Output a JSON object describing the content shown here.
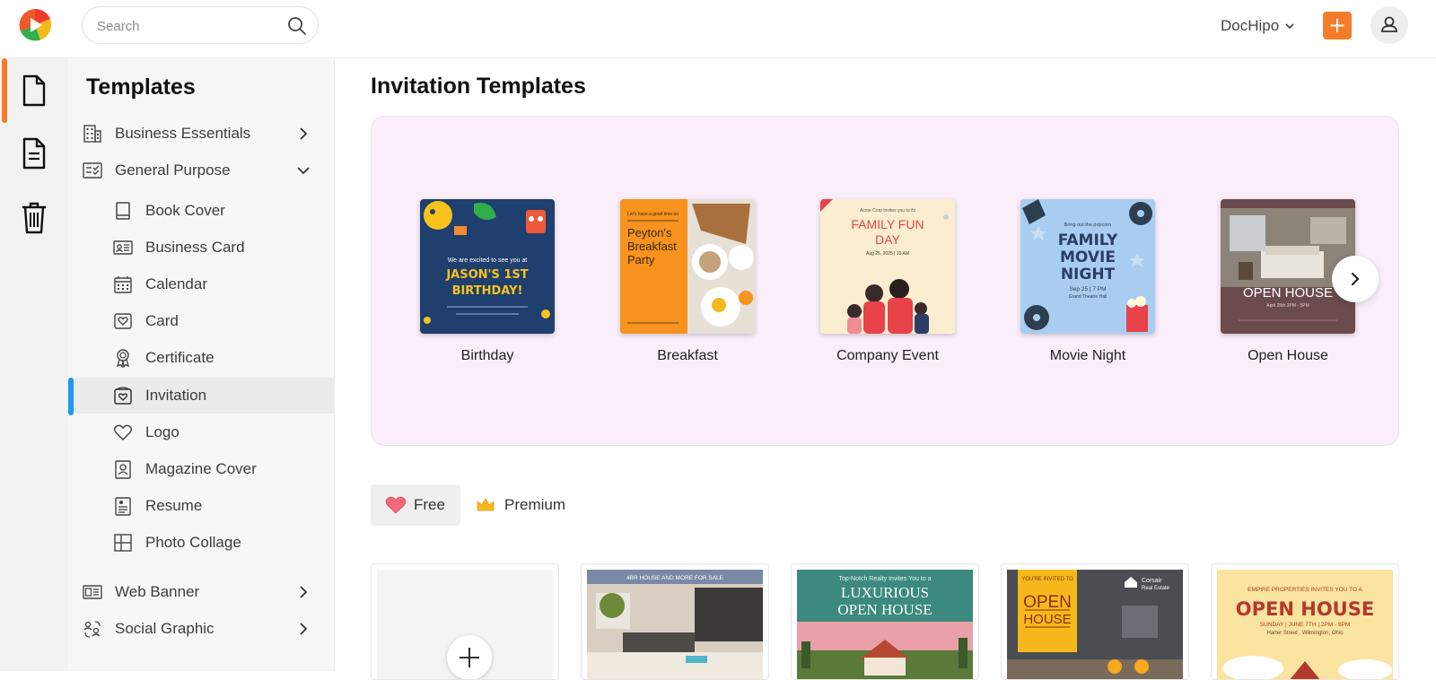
{
  "app": {
    "name": "DocHipo",
    "brand_color": "#f57c2a"
  },
  "search": {
    "placeholder": "Search"
  },
  "account": {
    "name": "DocHipo"
  },
  "sidebar": {
    "title": "Templates",
    "items": [
      {
        "label": "Business Essentials",
        "icon": "building-icon",
        "expanded": false
      },
      {
        "label": "General Purpose",
        "icon": "checklist-icon",
        "expanded": true
      },
      {
        "label": "Book Cover",
        "icon": "book-icon"
      },
      {
        "label": "Business Card",
        "icon": "id-card-icon"
      },
      {
        "label": "Calendar",
        "icon": "calendar-icon"
      },
      {
        "label": "Card",
        "icon": "heart-card-icon"
      },
      {
        "label": "Certificate",
        "icon": "award-icon"
      },
      {
        "label": "Invitation",
        "icon": "invitation-icon",
        "active": true
      },
      {
        "label": "Logo",
        "icon": "heart-outline-icon"
      },
      {
        "label": "Magazine Cover",
        "icon": "portrait-icon"
      },
      {
        "label": "Resume",
        "icon": "resume-icon"
      },
      {
        "label": "Photo Collage",
        "icon": "grid-icon"
      },
      {
        "label": "Web Banner",
        "icon": "banner-icon",
        "expanded": false
      },
      {
        "label": "Social Graphic",
        "icon": "social-icon",
        "expanded": false
      }
    ]
  },
  "main": {
    "title": "Invitation Templates",
    "categories": [
      {
        "label": "Birthday",
        "thumb_lines": [
          "We are excited to see you at",
          "JASON'S 1ST",
          "BIRTHDAY!"
        ]
      },
      {
        "label": "Breakfast",
        "thumb_lines": [
          "Let's have a good time on",
          "Peyton's",
          "Breakfast",
          "Party"
        ]
      },
      {
        "label": "Company Event",
        "thumb_lines": [
          "Acme Corp invites you to its",
          "FAMILY FUN",
          "DAY",
          "Aug 25, 2025 | 10 AM"
        ]
      },
      {
        "label": "Movie Night",
        "thumb_lines": [
          "Bring out the popcorn",
          "FAMILY",
          "MOVIE",
          "NIGHT",
          "Sep 25 | 7 PM",
          "Grand Theatre Hall"
        ]
      },
      {
        "label": "Open House",
        "thumb_lines": [
          "OPEN HOUSE",
          "April 25th 2PM - 5PM"
        ]
      }
    ],
    "filters": {
      "free": "Free",
      "premium": "Premium"
    },
    "templates": [
      {
        "kind": "blank"
      },
      {
        "title": "4BR HOUSE AND MORE FOR SALE"
      },
      {
        "title": "Top-Notch Realty Invites You to a",
        "headline": "LUXURIOUS",
        "headline2": "OPEN HOUSE"
      },
      {
        "title": "YOU'RE INVITED TO",
        "headline": "OPEN",
        "headline2": "HOUSE",
        "brand": "Corsair",
        "brand2": "Real Estate"
      },
      {
        "title": "EMPIRE PROPERTIES INVITES YOU TO A",
        "headline": "OPEN HOUSE",
        "detail": "SUNDAY | JUNE 7TH | 2PM - 8PM",
        "detail2": "Harter Street , Wilmington, Ohio"
      }
    ]
  }
}
